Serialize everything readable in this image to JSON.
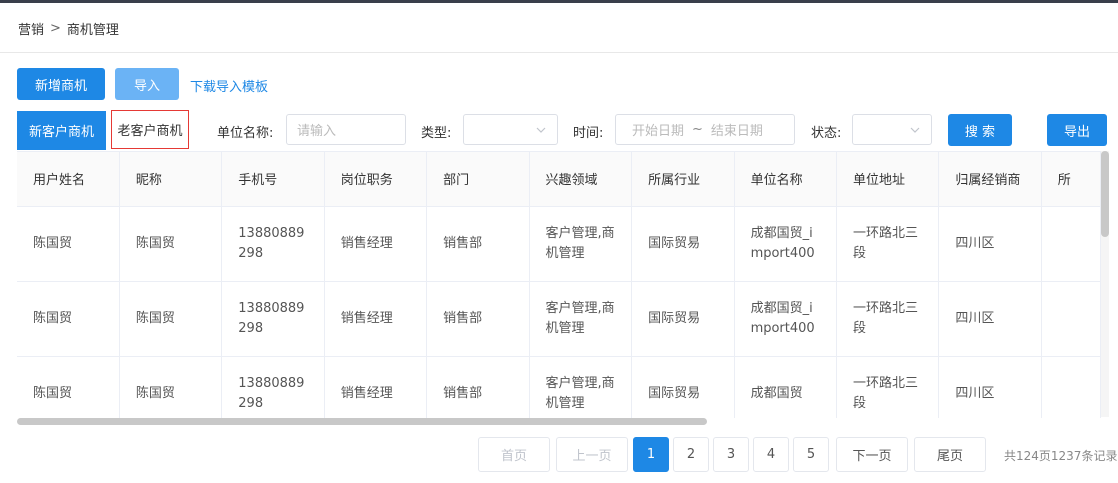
{
  "breadcrumb": {
    "parent": "营销",
    "separator": ">",
    "current": "商机管理"
  },
  "toolbar": {
    "add_label": "新增商机",
    "import_label": "导入",
    "download_template_label": "下载导入模板"
  },
  "tabs": [
    {
      "label": "新客户商机",
      "active": true
    },
    {
      "label": "老客户商机",
      "active": false
    }
  ],
  "filters": {
    "unit_name": {
      "label": "单位名称:",
      "placeholder": "请输入"
    },
    "type": {
      "label": "类型:",
      "value": ""
    },
    "time": {
      "label": "时间:",
      "start_placeholder": "开始日期",
      "separator": "~",
      "end_placeholder": "结束日期"
    },
    "status": {
      "label": "状态:",
      "value": ""
    },
    "search_label": "搜 索",
    "export_label": "导出"
  },
  "table": {
    "columns": [
      "用户姓名",
      "昵称",
      "手机号",
      "岗位职务",
      "部门",
      "兴趣领域",
      "所属行业",
      "单位名称",
      "单位地址",
      "归属经销商",
      "所"
    ],
    "rows": [
      [
        "陈国贸",
        "陈国贸",
        "13880889298",
        "销售经理",
        "销售部",
        "客户管理,商机管理",
        "国际贸易",
        "成都国贸_import400",
        "一环路北三段",
        "四川区",
        ""
      ],
      [
        "陈国贸",
        "陈国贸",
        "13880889298",
        "销售经理",
        "销售部",
        "客户管理,商机管理",
        "国际贸易",
        "成都国贸_import400",
        "一环路北三段",
        "四川区",
        ""
      ],
      [
        "陈国贸",
        "陈国贸",
        "13880889298",
        "销售经理",
        "销售部",
        "客户管理,商机管理",
        "国际贸易",
        "成都国贸",
        "一环路北三段",
        "四川区",
        ""
      ]
    ]
  },
  "pagination": {
    "first_label": "首页",
    "prev_label": "上一页",
    "pages": [
      "1",
      "2",
      "3",
      "4",
      "5"
    ],
    "current_page": "1",
    "next_label": "下一页",
    "last_label": "尾页",
    "total_text": "共124页1237条记录"
  },
  "colors": {
    "primary": "#1e88e5",
    "primary_light": "#6bb3f5",
    "tab_highlight_border": "#e53935"
  }
}
